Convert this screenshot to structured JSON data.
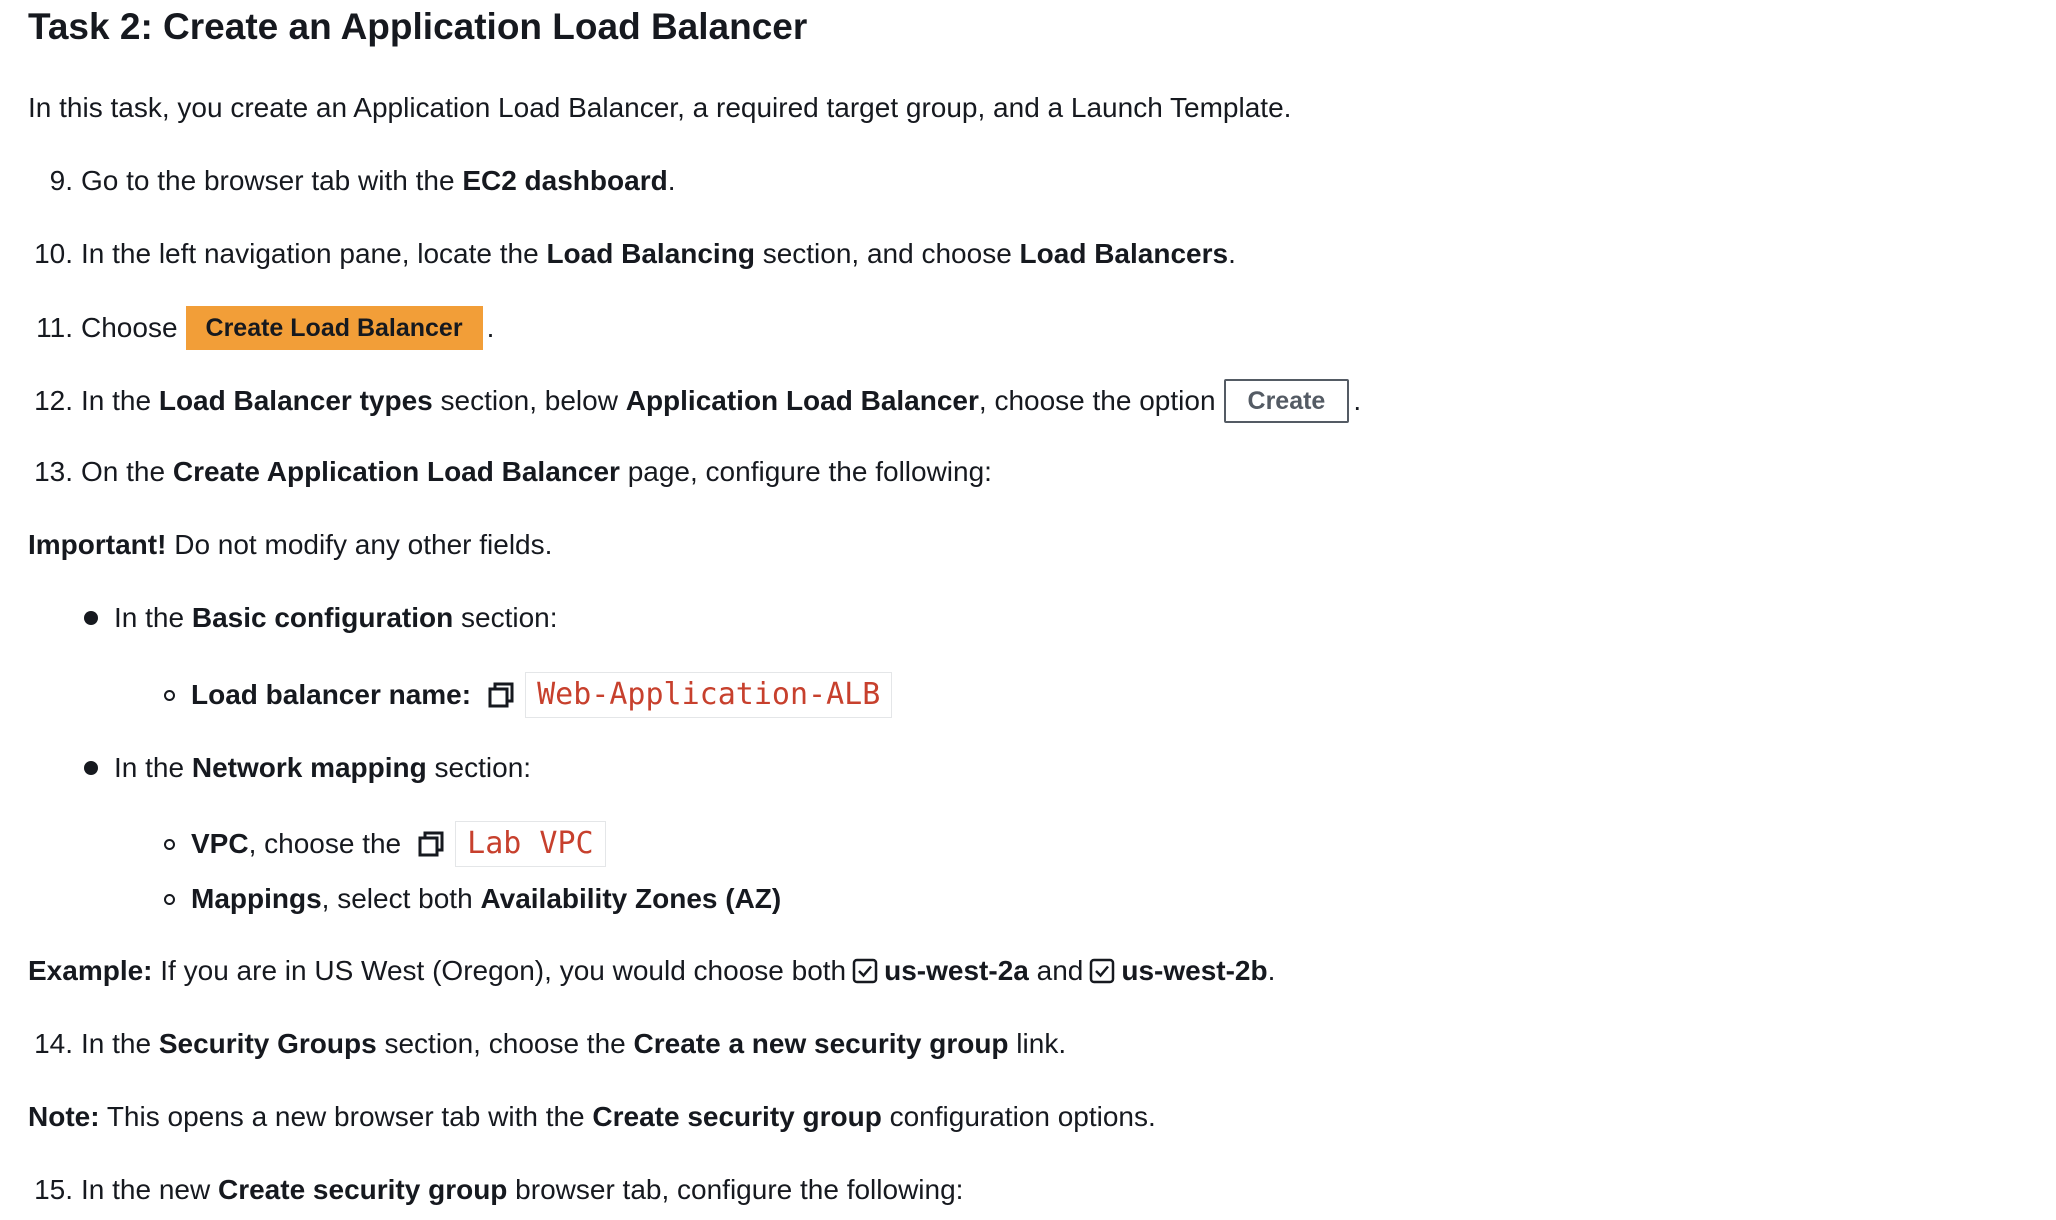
{
  "title": "Task 2: Create an Application Load Balancer",
  "intro": "In this task, you create an Application Load Balancer, a required target group, and a Launch Template.",
  "step9": {
    "num": "9.",
    "t1": "Go to the browser tab with the ",
    "b1": "EC2 dashboard",
    "t2": "."
  },
  "step10": {
    "num": "10.",
    "t1": "In the left navigation pane, locate the ",
    "b1": "Load Balancing",
    "t2": " section, and choose ",
    "b2": "Load Balancers",
    "t3": "."
  },
  "step11": {
    "num": "11.",
    "t1": "Choose",
    "button": "Create Load Balancer",
    "t2": "."
  },
  "step12": {
    "num": "12.",
    "t1": "In the ",
    "b1": "Load Balancer types",
    "t2": " section, below ",
    "b2": "Application Load Balancer",
    "t3": ", choose the option",
    "button": "Create",
    "t4": "."
  },
  "step13": {
    "num": "13.",
    "t1": "On the ",
    "b1": "Create Application Load Balancer",
    "t2": " page, configure the following:"
  },
  "important": {
    "b1": "Important!",
    "t1": " Do not modify any other fields."
  },
  "basic": {
    "t1": "In the ",
    "b1": "Basic configuration",
    "t2": " section:"
  },
  "lbname": {
    "b1": "Load balancer name:",
    "code": "Web-Application-ALB"
  },
  "network": {
    "t1": "In the ",
    "b1": "Network mapping",
    "t2": " section:"
  },
  "vpc": {
    "b1": "VPC",
    "t1": ", choose the",
    "code": "Lab VPC"
  },
  "mappings": {
    "b1": "Mappings",
    "t1": ", select both ",
    "b2": "Availability Zones (AZ)"
  },
  "example": {
    "b1": "Example:",
    "t1": " If you are in US West (Oregon), you would choose both",
    "b2": "us-west-2a",
    "t2": " and",
    "b3": "us-west-2b",
    "t3": "."
  },
  "step14": {
    "num": "14.",
    "t1": "In the ",
    "b1": "Security Groups",
    "t2": " section, choose the ",
    "b2": "Create a new security group",
    "t3": " link."
  },
  "note": {
    "b1": "Note:",
    "t1": " This opens a new browser tab with the ",
    "b2": "Create security group",
    "t2": " configuration options."
  },
  "step15": {
    "num": "15.",
    "t1": "In the new ",
    "b1": "Create security group",
    "t2": " browser tab, configure the following:"
  },
  "colors": {
    "primary_button": "#f29e38",
    "code_text": "#c7402d",
    "text": "#16191f"
  }
}
